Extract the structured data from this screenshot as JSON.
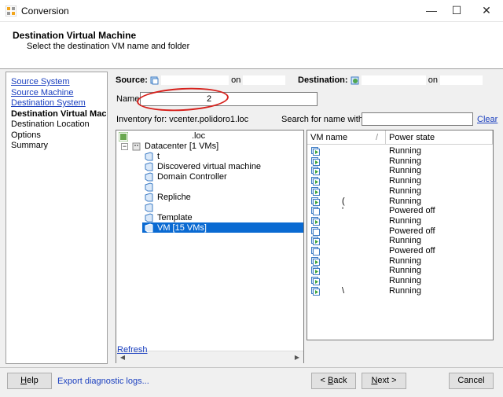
{
  "window": {
    "title": "Conversion",
    "controls": [
      "—",
      "☐",
      "✕"
    ]
  },
  "header": {
    "title": "Destination Virtual Machine",
    "subtitle": "Select the destination VM name and folder"
  },
  "nav": {
    "items": [
      {
        "label": "Source System",
        "style": "link"
      },
      {
        "label": "Source Machine",
        "style": "link"
      },
      {
        "label": "Destination System",
        "style": "link"
      },
      {
        "label": "Destination Virtual Machi",
        "style": "bold"
      },
      {
        "label": "Destination Location",
        "style": "plain"
      },
      {
        "label": "Options",
        "style": "plain"
      },
      {
        "label": "Summary",
        "style": "plain"
      }
    ]
  },
  "summary": {
    "source_label": "Source:",
    "source_on": "on",
    "destination_label": "Destination:",
    "destination_on": "on"
  },
  "name_field": {
    "label": "Name",
    "value": "2"
  },
  "inventory": {
    "label": "Inventory for:",
    "host": "vcenter.polidoro1.loc"
  },
  "search": {
    "label": "Search for name with:",
    "value": "",
    "clear_label": "Clear"
  },
  "tree": {
    "root_label": ".loc",
    "datacenter_label": "Datacenter [1 VMs]",
    "folders": [
      {
        "label": "t",
        "selected": false
      },
      {
        "label": "Discovered virtual machine",
        "selected": false
      },
      {
        "label": "Domain Controller",
        "selected": false
      },
      {
        "label": "",
        "selected": false
      },
      {
        "label": "Repliche",
        "selected": false
      },
      {
        "label": "",
        "selected": false
      },
      {
        "label": "Template",
        "selected": false
      },
      {
        "label": "VM [15 VMs]",
        "selected": true
      }
    ]
  },
  "vm_table": {
    "columns": [
      "VM name",
      "Power state"
    ],
    "rows": [
      {
        "name": "",
        "state": "Running"
      },
      {
        "name": "",
        "state": "Running"
      },
      {
        "name": "",
        "state": "Running"
      },
      {
        "name": "",
        "state": "Running"
      },
      {
        "name": "",
        "state": "Running"
      },
      {
        "name": "(",
        "state": "Running"
      },
      {
        "name": "'",
        "state": "Powered off"
      },
      {
        "name": "",
        "state": "Running"
      },
      {
        "name": "",
        "state": "Powered off"
      },
      {
        "name": "",
        "state": "Running"
      },
      {
        "name": "",
        "state": "Powered off"
      },
      {
        "name": "",
        "state": "Running"
      },
      {
        "name": "",
        "state": "Running"
      },
      {
        "name": "",
        "state": "Running"
      },
      {
        "name": "\\",
        "state": "Running"
      }
    ]
  },
  "refresh_label": "Refresh",
  "footer": {
    "help": "Help",
    "export_logs": "Export diagnostic logs...",
    "back": "< Back",
    "next": "Next >",
    "cancel": "Cancel"
  },
  "colors": {
    "link": "#1a3fbf",
    "selection": "#0a6ad2",
    "annotation": "#d6201b"
  }
}
